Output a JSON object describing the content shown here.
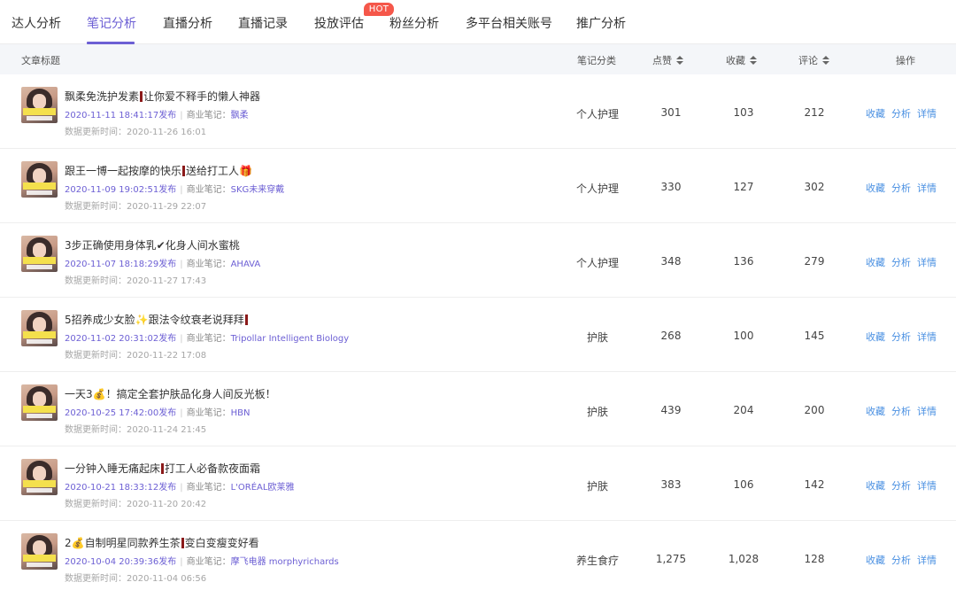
{
  "tabs": [
    {
      "label": "达人分析"
    },
    {
      "label": "笔记分析",
      "active": true
    },
    {
      "label": "直播分析"
    },
    {
      "label": "直播记录"
    },
    {
      "label": "投放评估"
    },
    {
      "label": "粉丝分析"
    },
    {
      "label": "多平台相关账号"
    },
    {
      "label": "推广分析"
    }
  ],
  "hot_badge": "HOT",
  "table": {
    "headers": {
      "title": "文章标题",
      "category": "笔记分类",
      "likes": "点赞",
      "favorites": "收藏",
      "comments": "评论",
      "actions": "操作"
    },
    "meta_separator": "|",
    "commercial_label": "商业笔记：",
    "actions": [
      "收藏",
      "分析",
      "详情"
    ],
    "rows": [
      {
        "title_parts": [
          "飘柔免洗护发素",
          "让你爱不释手的懒人神器"
        ],
        "published": "2020-11-11 18:41:17发布",
        "brand": "飘柔",
        "updated": "数据更新时间：2020-11-26 16:01",
        "category": "个人护理",
        "likes": "301",
        "favorites": "103",
        "comments": "212"
      },
      {
        "title_parts": [
          "跟王一博一起按摩的快乐",
          "送给打工人🎁"
        ],
        "published": "2020-11-09 19:02:51发布",
        "brand": "SKG未来穿戴",
        "updated": "数据更新时间：2020-11-29 22:07",
        "category": "个人护理",
        "likes": "330",
        "favorites": "127",
        "comments": "302"
      },
      {
        "title_parts": [
          "3步正确使用身体乳✔化身人间水蜜桃"
        ],
        "published": "2020-11-07 18:18:29发布",
        "brand": "AHAVA",
        "updated": "数据更新时间：2020-11-27 17:43",
        "category": "个人护理",
        "likes": "348",
        "favorites": "136",
        "comments": "279"
      },
      {
        "title_parts": [
          "5招养成少女脸✨跟法令纹衰老说拜拜",
          ""
        ],
        "published": "2020-11-02 20:31:02发布",
        "brand": "Tripollar Intelligent Biology",
        "updated": "数据更新时间：2020-11-22 17:08",
        "category": "护肤",
        "likes": "268",
        "favorites": "100",
        "comments": "145"
      },
      {
        "title_parts": [
          "一天3💰！搞定全套护肤品化身人间反光板！"
        ],
        "published": "2020-10-25 17:42:00发布",
        "brand": "HBN",
        "updated": "数据更新时间：2020-11-24 21:45",
        "category": "护肤",
        "likes": "439",
        "favorites": "204",
        "comments": "200"
      },
      {
        "title_parts": [
          "一分钟入睡无痛起床",
          "打工人必备款夜面霜"
        ],
        "published": "2020-10-21 18:33:12发布",
        "brand": "L'ORÉAL欧莱雅",
        "updated": "数据更新时间：2020-11-20 20:42",
        "category": "护肤",
        "likes": "383",
        "favorites": "106",
        "comments": "142"
      },
      {
        "title_parts": [
          "2💰自制明星同款养生茶",
          "变白变瘦变好看"
        ],
        "published": "2020-10-04 20:39:36发布",
        "brand": "摩飞电器 morphyrichards",
        "updated": "数据更新时间：2020-11-04 06:56",
        "category": "养生食疗",
        "likes": "1,275",
        "favorites": "1,028",
        "comments": "128"
      }
    ]
  }
}
